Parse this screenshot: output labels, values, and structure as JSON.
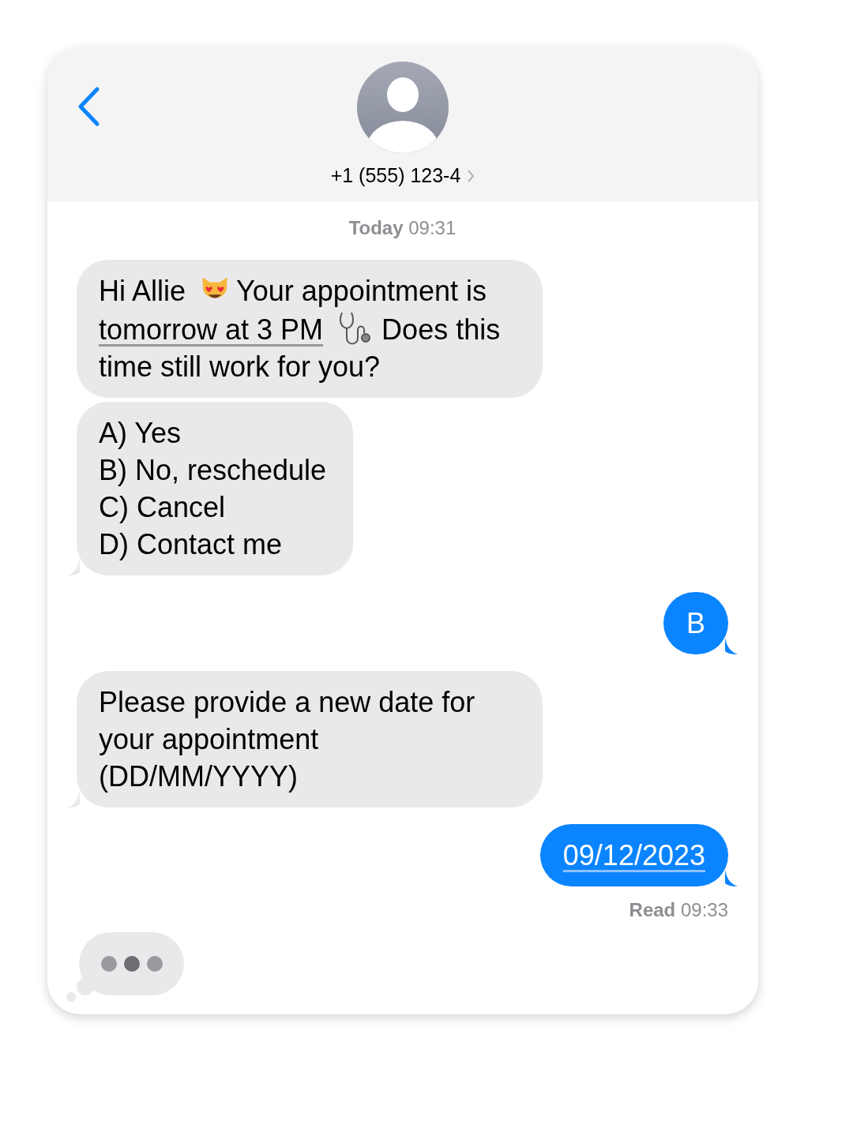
{
  "header": {
    "contact": "+1 (555) 123-4"
  },
  "timestamp": {
    "label": "Today",
    "time": "09:31"
  },
  "messages": [
    {
      "outgoing": false,
      "kind": "rich",
      "tail": false,
      "segments": [
        {
          "kind": "text",
          "text": "Hi Allie"
        },
        {
          "kind": "cat-emoji"
        },
        {
          "kind": "text",
          "text": "Your appointment is"
        },
        {
          "kind": "link",
          "text": "tomorrow at 3 PM"
        },
        {
          "kind": "stethoscope-emoji"
        },
        {
          "kind": "text",
          "text": "Does this time still work for you?"
        }
      ]
    },
    {
      "outgoing": false,
      "kind": "lines",
      "tail": true,
      "lines": [
        "A) Yes",
        "B) No, reschedule",
        "C) Cancel",
        "D) Contact me"
      ]
    },
    {
      "outgoing": true,
      "kind": "rich",
      "tail": true,
      "segments": [
        {
          "kind": "text",
          "text": "B"
        }
      ]
    },
    {
      "outgoing": false,
      "kind": "rich",
      "tail": true,
      "segments": [
        {
          "kind": "text",
          "text": "Please provide a new date for your appointment (DD/MM/YYYY)"
        }
      ]
    },
    {
      "outgoing": true,
      "kind": "rich",
      "tail": true,
      "segments": [
        {
          "kind": "link",
          "text": "09/12/2023"
        }
      ]
    }
  ],
  "receipt": {
    "label": "Read",
    "time": "09:33"
  },
  "typing": true
}
